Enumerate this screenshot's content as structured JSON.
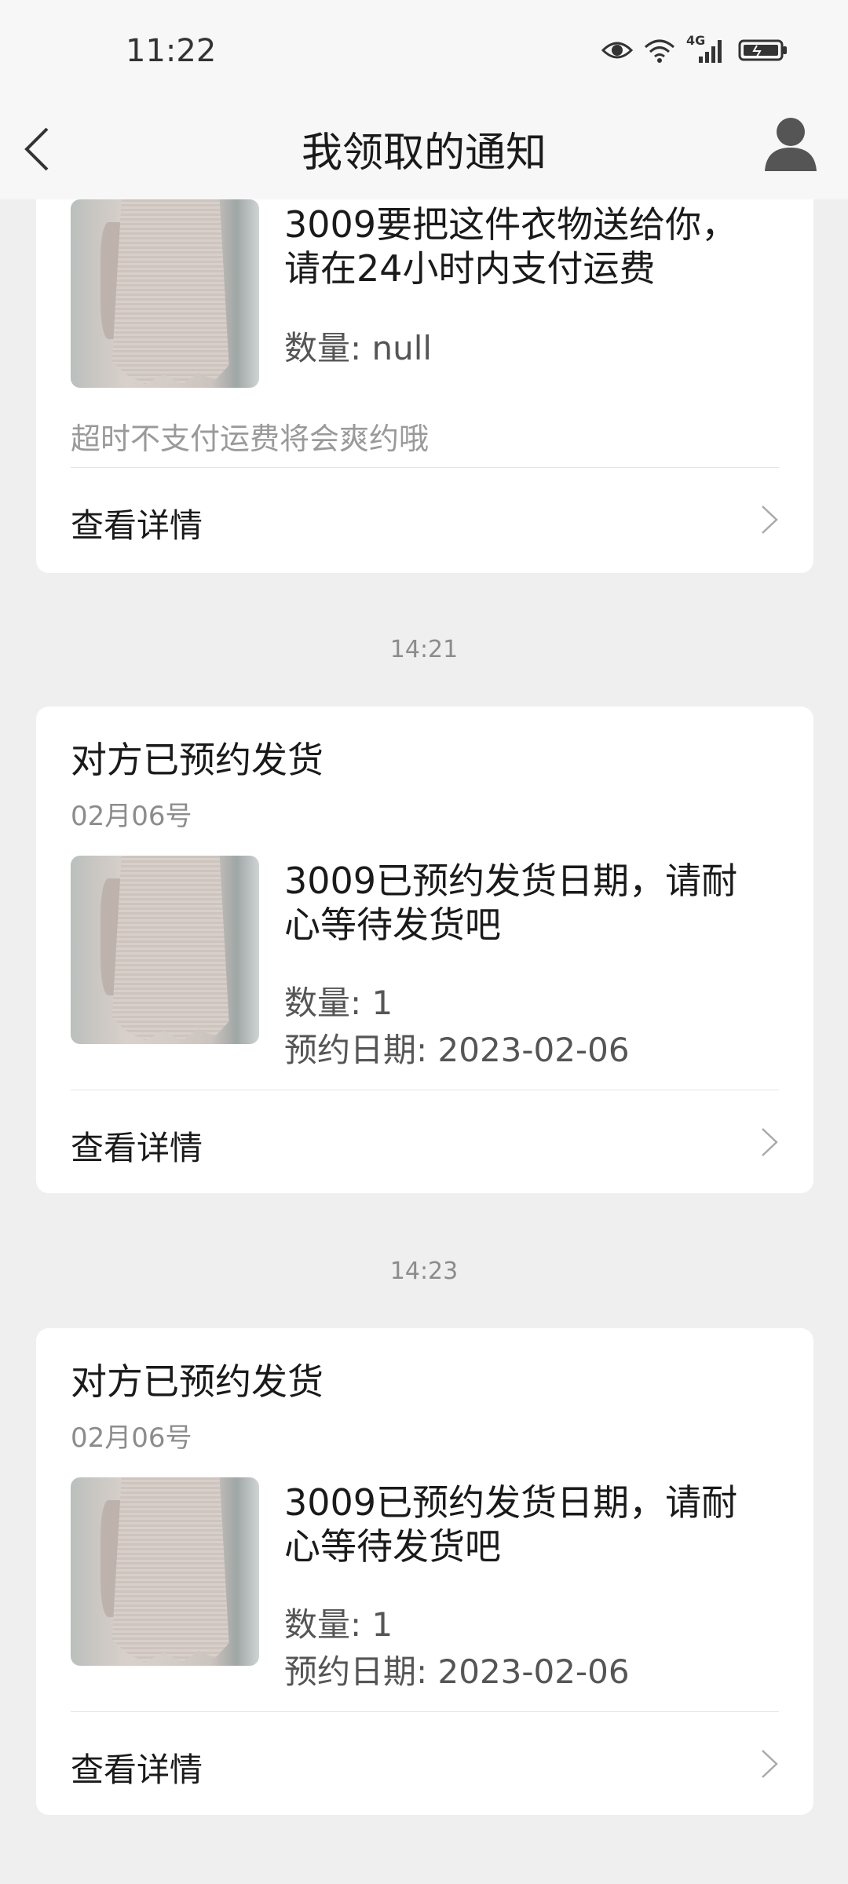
{
  "status_bar": {
    "time": "11:22",
    "network_label": "4G",
    "icons": [
      "eye-icon",
      "wifi-icon",
      "signal-icon",
      "battery-icon"
    ]
  },
  "nav": {
    "title": "我领取的通知",
    "back_icon": "chevron-left-icon",
    "profile_icon": "user-icon"
  },
  "notifications": [
    {
      "message": "3009要把这件衣物送给你，请在24小时内支付运费",
      "quantity": "数量: null",
      "note": "超时不支付运费将会爽约哦",
      "detail_label": "查看详情"
    },
    {
      "timestamp": "14:21",
      "title": "对方已预约发货",
      "date": "02月06号",
      "message": "3009已预约发货日期，请耐心等待发货吧",
      "quantity": "数量: 1",
      "appointment": "预约日期: 2023-02-06",
      "detail_label": "查看详情"
    },
    {
      "timestamp": "14:23",
      "title": "对方已预约发货",
      "date": "02月06号",
      "message": "3009已预约发货日期，请耐心等待发货吧",
      "quantity": "数量: 1",
      "appointment": "预约日期: 2023-02-06",
      "detail_label": "查看详情"
    }
  ],
  "colors": {
    "page_background": "#efefef",
    "card_background": "#ffffff",
    "secondary_text": "#8c8c8c"
  }
}
